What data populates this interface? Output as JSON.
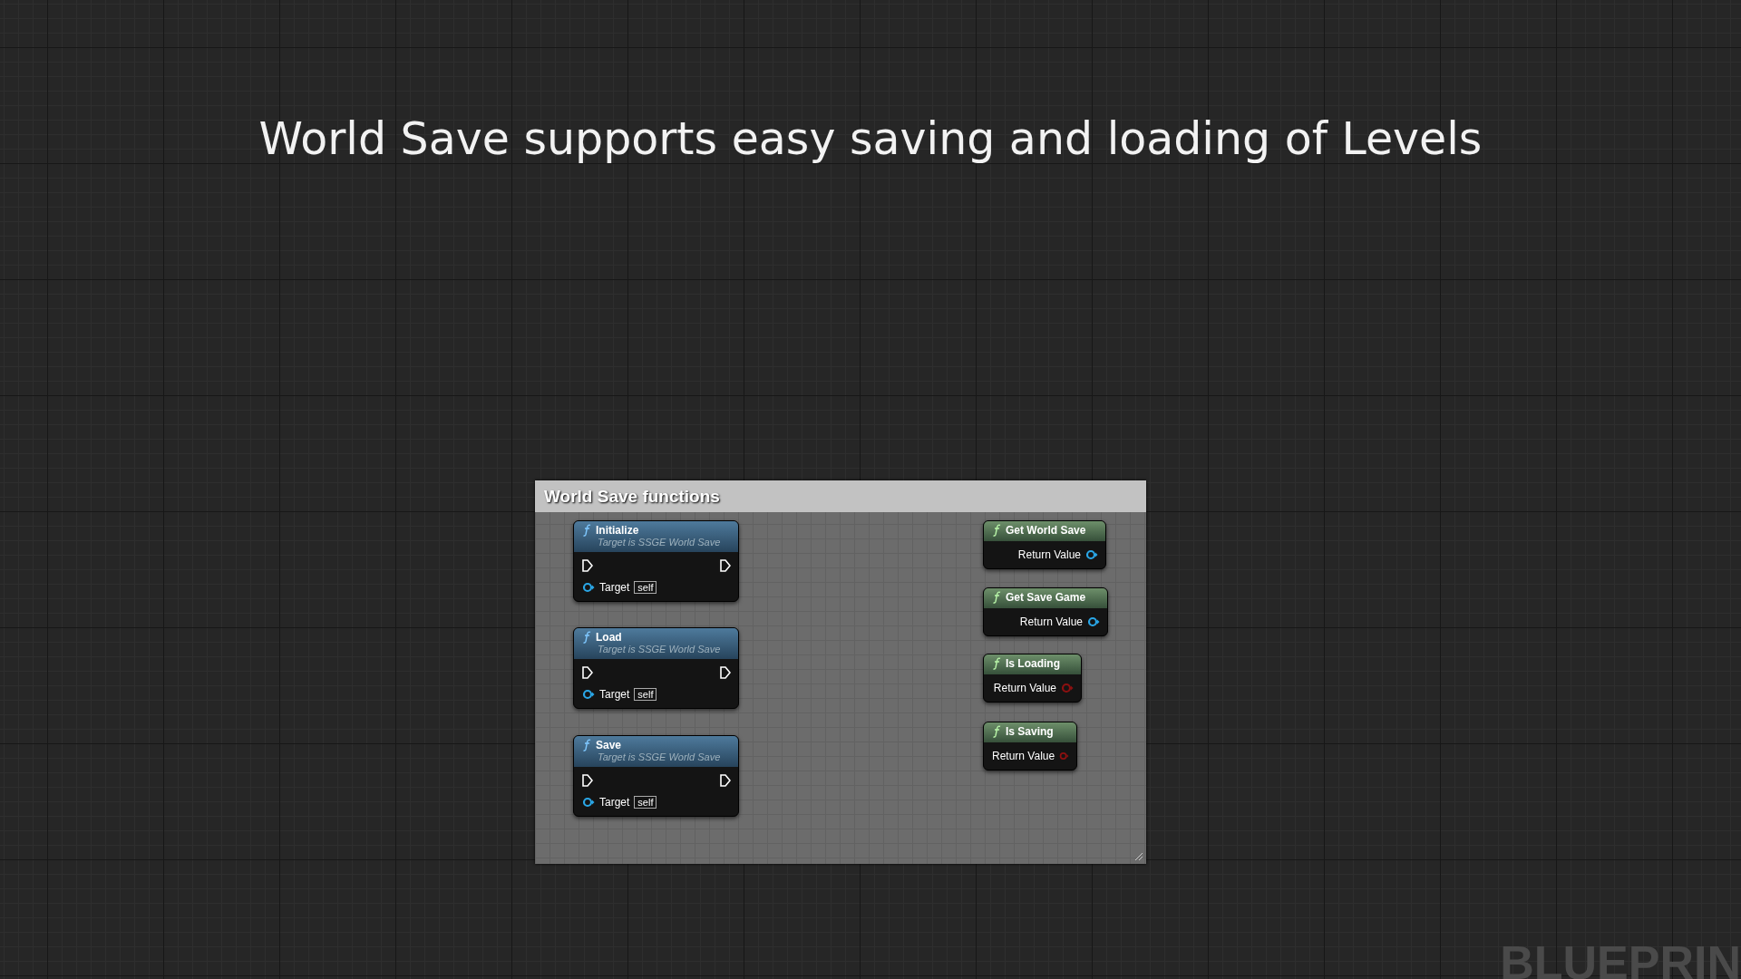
{
  "headline": "World Save supports easy saving and loading of Levels",
  "comment": {
    "title": "World Save functions"
  },
  "nodes": [
    {
      "kind": "callable",
      "title": "Initialize",
      "subtitle": "Target is SSGE World Save",
      "input_label": "Target",
      "input_value": "self"
    },
    {
      "kind": "callable",
      "title": "Load",
      "subtitle": "Target is SSGE World Save",
      "input_label": "Target",
      "input_value": "self"
    },
    {
      "kind": "callable",
      "title": "Save",
      "subtitle": "Target is SSGE World Save",
      "input_label": "Target",
      "input_value": "self"
    },
    {
      "kind": "pure",
      "title": "Get World Save",
      "output": {
        "label": "Return Value",
        "color": "#2aa6e6"
      }
    },
    {
      "kind": "pure",
      "title": "Get Save Game",
      "output": {
        "label": "Return Value",
        "color": "#2aa6e6"
      }
    },
    {
      "kind": "pure",
      "title": "Is Loading",
      "output": {
        "label": "Return Value",
        "color": "#8c1010"
      }
    },
    {
      "kind": "pure",
      "title": "Is Saving",
      "output": {
        "label": "Return Value",
        "color": "#8c1010"
      }
    }
  ],
  "watermark_label": "BLUEPRIN"
}
